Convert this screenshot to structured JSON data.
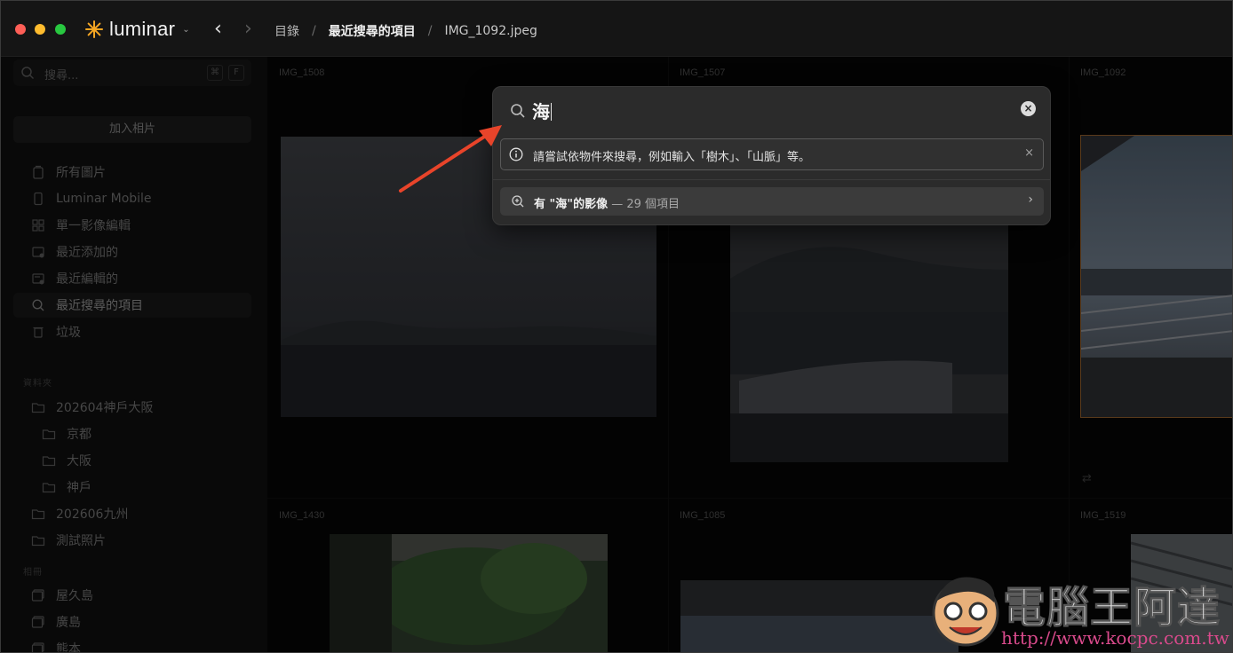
{
  "app": {
    "name": "luminar",
    "accent": "#f5a623"
  },
  "breadcrumb": {
    "items": [
      "目錄",
      "最近搜尋的項目",
      "IMG_1092.jpeg"
    ],
    "separator": "/"
  },
  "sidebar": {
    "search_placeholder": "搜尋...",
    "shortcut_cmd": "⌘",
    "shortcut_key": "F",
    "add_photos": "加入相片",
    "library": [
      {
        "label": "所有圖片",
        "icon": "photos-icon"
      },
      {
        "label": "Luminar Mobile",
        "icon": "phone-icon"
      },
      {
        "label": "單一影像編輯",
        "icon": "grid-icon"
      },
      {
        "label": "最近添加的",
        "icon": "recently-added-icon"
      },
      {
        "label": "最近編輯的",
        "icon": "recently-edited-icon"
      },
      {
        "label": "最近搜尋的項目",
        "icon": "search-icon",
        "active": true
      },
      {
        "label": "垃圾",
        "icon": "trash-icon"
      }
    ],
    "folders_header": "資料夾",
    "folders": [
      {
        "label": "202604神戶大阪",
        "sub": false
      },
      {
        "label": "京都",
        "sub": true
      },
      {
        "label": "大阪",
        "sub": true
      },
      {
        "label": "神戶",
        "sub": true
      },
      {
        "label": "202606九州",
        "sub": false
      },
      {
        "label": "測試照片",
        "sub": false
      }
    ],
    "albums_header": "相冊",
    "albums": [
      "屋久島",
      "廣島",
      "熊本"
    ]
  },
  "grid": {
    "labels": [
      "IMG_1508",
      "IMG_1507",
      "IMG_1092",
      "IMG_1430",
      "IMG_1085",
      "IMG_1519"
    ]
  },
  "search_popover": {
    "query": "海",
    "hint": "請嘗試依物件來搜尋，例如輸入「樹木」、「山脈」等。",
    "hint_close": "×",
    "result_prefix": "有 \"海\"的影像",
    "result_count": " — 29 個項目",
    "result_arrow": "›"
  },
  "watermark": {
    "title": "電腦王阿達",
    "url": "http://www.kocpc.com.tw"
  }
}
